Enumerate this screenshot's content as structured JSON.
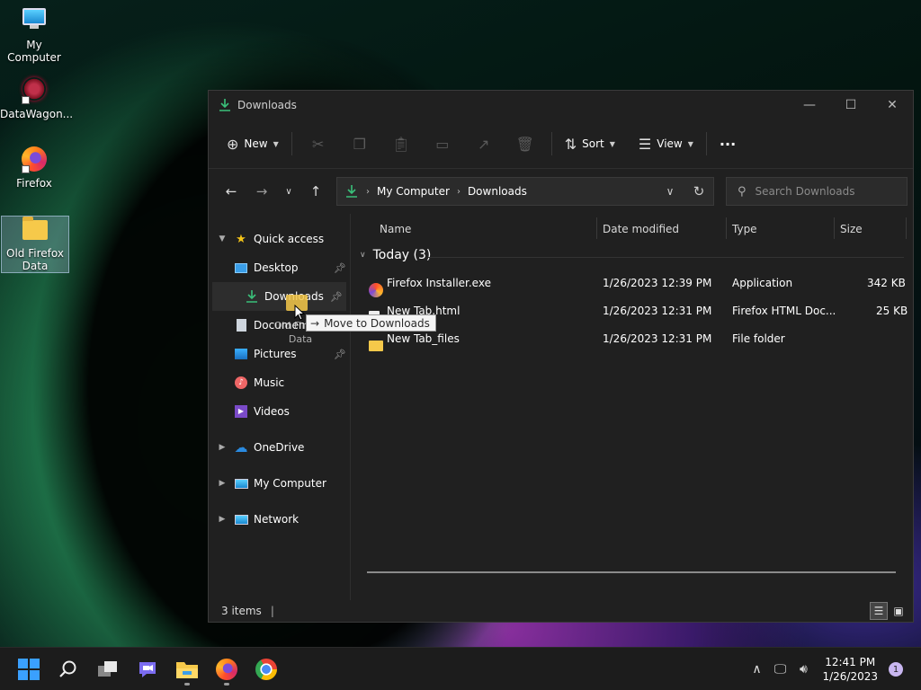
{
  "desktop": {
    "icons": [
      {
        "label": "My Computer"
      },
      {
        "label": "DataWagon..."
      },
      {
        "label": "Firefox"
      },
      {
        "label": "Old Firefox Data"
      }
    ]
  },
  "window": {
    "title": "Downloads",
    "toolbar": {
      "new_label": "New",
      "sort_label": "Sort",
      "view_label": "View",
      "more_label": "···"
    },
    "address": {
      "segments": [
        "My Computer",
        "Downloads"
      ]
    },
    "search": {
      "placeholder": "Search Downloads"
    },
    "nav": {
      "quick_access": "Quick access",
      "items": [
        "Desktop",
        "Downloads",
        "Documents",
        "Pictures",
        "Music",
        "Videos"
      ],
      "onedrive": "OneDrive",
      "my_computer": "My Computer",
      "network": "Network"
    },
    "columns": {
      "name": "Name",
      "date": "Date modified",
      "type": "Type",
      "size": "Size"
    },
    "group": {
      "label": "Today (3)"
    },
    "files": [
      {
        "name": "Firefox Installer.exe",
        "date": "1/26/2023 12:39 PM",
        "type": "Application",
        "size": "342 KB"
      },
      {
        "name": "New Tab.html",
        "date": "1/26/2023 12:31 PM",
        "type": "Firefox HTML Doc...",
        "size": "25 KB"
      },
      {
        "name": "New Tab_files",
        "date": "1/26/2023 12:31 PM",
        "type": "File folder",
        "size": ""
      }
    ],
    "status": {
      "items": "3 items",
      "sep": "|"
    }
  },
  "drag": {
    "tooltip": "Move to Downloads",
    "ghost_label": "Old Firefox Data"
  },
  "taskbar": {
    "time": "12:41 PM",
    "date": "1/26/2023",
    "notifications": "1"
  },
  "colors": {
    "accent": "#3aa0ff",
    "download_green": "#3ac07a",
    "folder": "#f6c94a"
  }
}
